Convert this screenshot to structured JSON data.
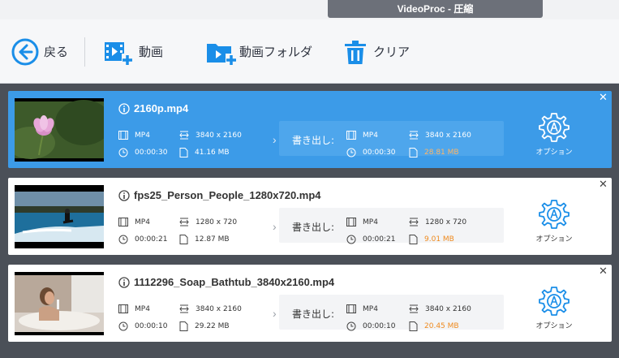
{
  "window": {
    "title": "VideoProc - 圧縮"
  },
  "toolbar": {
    "back_label": "戻る",
    "video_label": "動画",
    "folder_label": "動画フォルダ",
    "clear_label": "クリア"
  },
  "colors": {
    "accent": "#3c9be8",
    "orange": "#ef8a1e",
    "list_bg": "#4b5058"
  },
  "files": [
    {
      "name": "2160p.mp4",
      "selected": true,
      "source": {
        "format": "MP4",
        "resolution": "3840 x 2160",
        "duration": "00:00:30",
        "size": "41.16 MB"
      },
      "output": {
        "format": "MP4",
        "resolution": "3840 x 2160",
        "duration": "00:00:30",
        "size": "28.81 MB"
      }
    },
    {
      "name": "fps25_Person_People_1280x720.mp4",
      "selected": false,
      "source": {
        "format": "MP4",
        "resolution": "1280 x 720",
        "duration": "00:00:21",
        "size": "12.87 MB"
      },
      "output": {
        "format": "MP4",
        "resolution": "1280 x 720",
        "duration": "00:00:21",
        "size": "9.01 MB"
      }
    },
    {
      "name": "1112296_Soap_Bathtub_3840x2160.mp4",
      "selected": false,
      "source": {
        "format": "MP4",
        "resolution": "3840 x 2160",
        "duration": "00:00:10",
        "size": "29.22 MB"
      },
      "output": {
        "format": "MP4",
        "resolution": "3840 x 2160",
        "duration": "00:00:10",
        "size": "20.45 MB"
      }
    }
  ],
  "card_labels": {
    "export_label": "書き出し:",
    "option_label": "オプション",
    "close_glyph": "✕",
    "arrow_glyph": "›"
  }
}
